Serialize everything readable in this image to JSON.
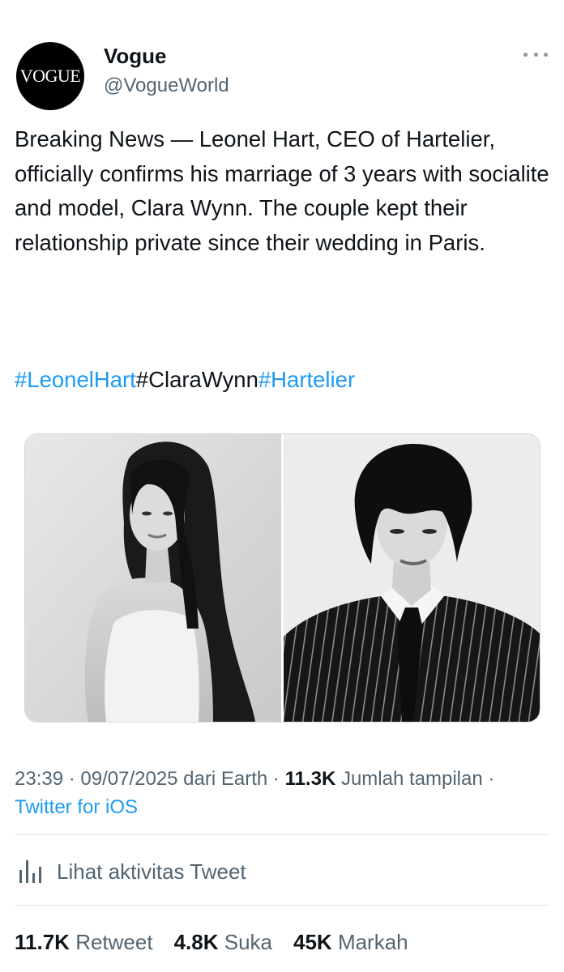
{
  "author": {
    "avatar_text": "VOGUE",
    "display_name": "Vogue",
    "handle": "@VogueWorld"
  },
  "tweet": {
    "text": "Breaking News — Leonel Hart, CEO of Hartelier, officially confirms his marriage of 3 years with socialite and model, Clara Wynn. The couple kept their relationship private since their wedding in Paris.",
    "hashtags": [
      "#LeonelHart",
      "#ClaraWynn",
      "#Hartelier"
    ]
  },
  "meta": {
    "time": "23:39",
    "separator": " · ",
    "date": "09/07/2025",
    "location": " dari Earth",
    "views_count": "11.3K",
    "views_label": " Jumlah tampilan",
    "source": "Twitter for iOS"
  },
  "activity": {
    "icon": "analytics-bars-icon",
    "label": "Lihat aktivitas Tweet"
  },
  "stats": [
    {
      "count": "11.7K",
      "label": "Retweet"
    },
    {
      "count": "4.8K",
      "label": "Suka"
    },
    {
      "count": "45K",
      "label": "Markah"
    }
  ],
  "colors": {
    "link": "#1d9bf0",
    "secondary_text": "#536471",
    "primary_text": "#0f1419",
    "divider": "#dfe4e8"
  }
}
